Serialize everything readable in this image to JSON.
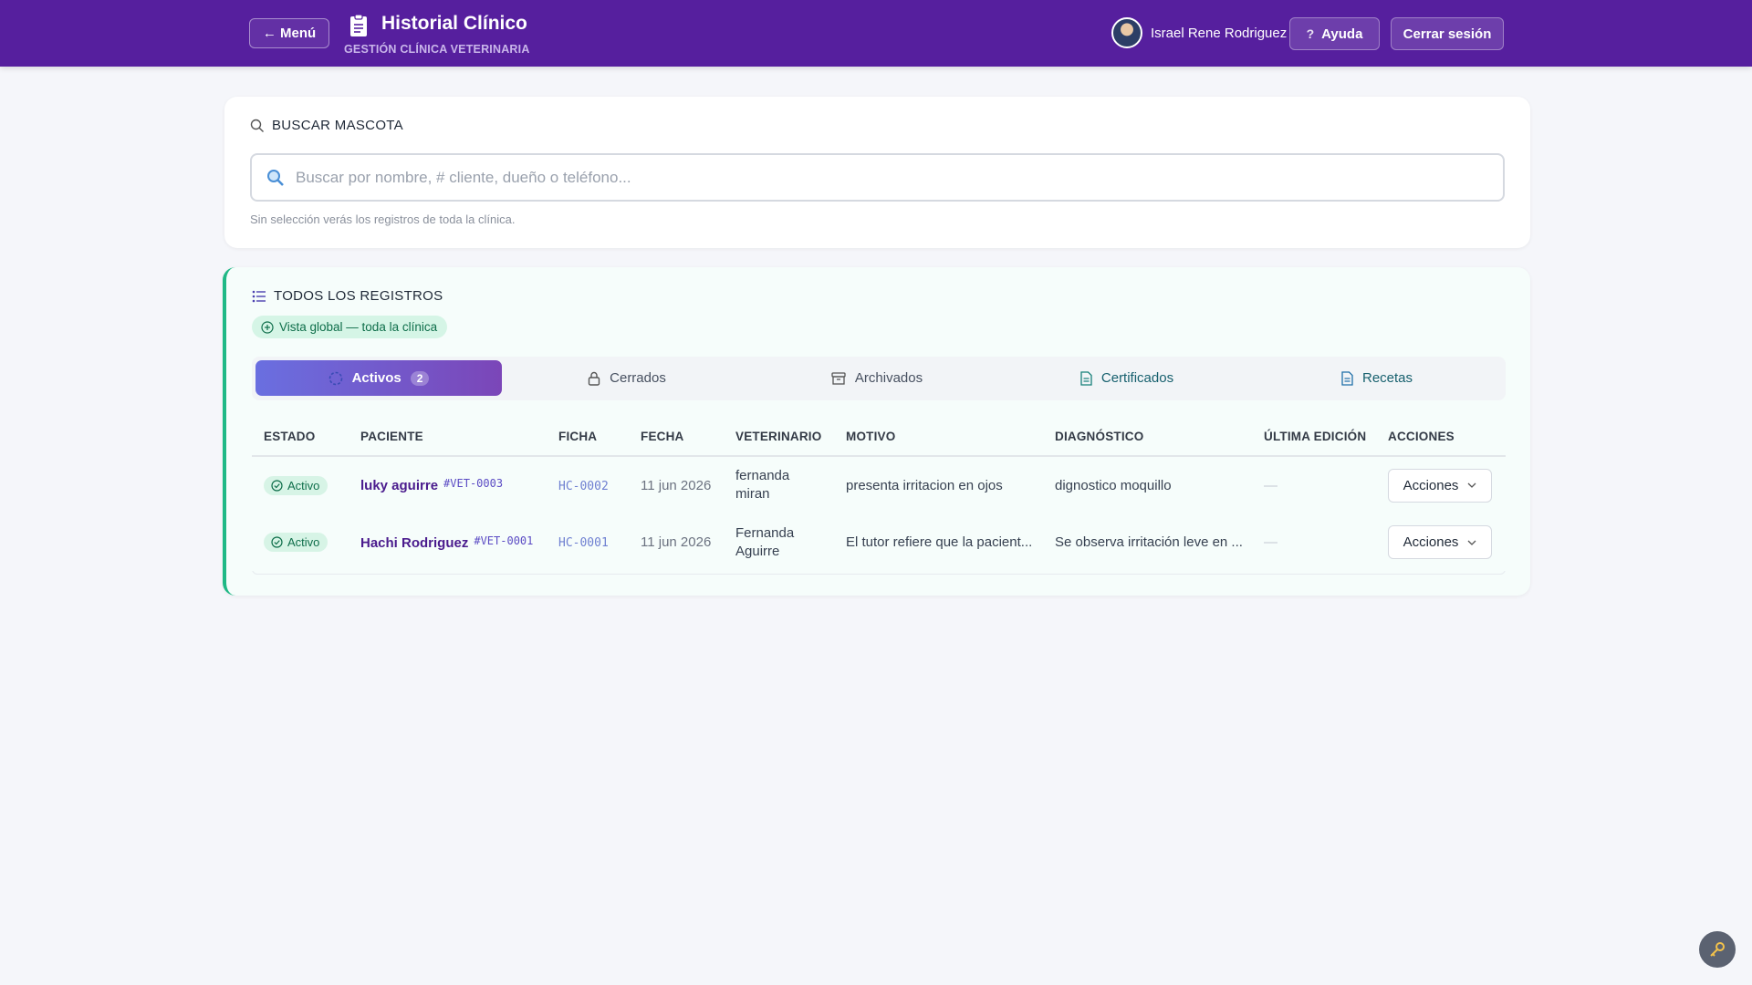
{
  "header": {
    "menu_label": "← Menú",
    "title": "Historial Clínico",
    "subtitle": "GESTIÓN CLÍNICA VETERINARIA",
    "user_name": "Israel Rene Rodriguez",
    "help_label": "Ayuda",
    "logout_label": "Cerrar sesión"
  },
  "search": {
    "section_title": "BUSCAR MASCOTA",
    "placeholder": "Buscar por nombre, # cliente, dueño o teléfono...",
    "value": "",
    "hint": "Sin selección verás los registros de toda la clínica."
  },
  "records": {
    "section_title": "TODOS LOS REGISTROS",
    "chip_label": "Vista global — toda la clínica",
    "tabs": [
      {
        "label": "Activos",
        "count": "2",
        "icon": "circle-icon"
      },
      {
        "label": "Cerrados",
        "icon": "lock-icon"
      },
      {
        "label": "Archivados",
        "icon": "archive-icon"
      },
      {
        "label": "Certificados",
        "icon": "document-icon"
      },
      {
        "label": "Recetas",
        "icon": "document-icon"
      }
    ],
    "columns": [
      "ESTADO",
      "PACIENTE",
      "FICHA",
      "FECHA",
      "VETERINARIO",
      "MOTIVO",
      "DIAGNÓSTICO",
      "ÚLTIMA EDICIÓN",
      "ACCIONES"
    ],
    "rows": [
      {
        "status": "Activo",
        "patient": "luky aguirre",
        "patient_id": "#VET-0003",
        "ficha": "HC-0002",
        "date": "11 jun 2026",
        "vet_line1": "fernanda",
        "vet_line2": "miran",
        "reason": "presenta irritacion en ojos",
        "diagnosis": "dignostico moquillo",
        "last_edit": "—",
        "actions_label": "Acciones"
      },
      {
        "status": "Activo",
        "patient": "Hachi Rodriguez",
        "patient_id": "#VET-0001",
        "ficha": "HC-0001",
        "date": "11 jun 2026",
        "vet_line1": "Fernanda",
        "vet_line2": "Aguirre",
        "reason": "El tutor refiere que la pacient...",
        "diagnosis": "Se observa irritación leve en ...",
        "last_edit": "—",
        "actions_label": "Acciones"
      }
    ]
  },
  "colors": {
    "header_bg": "#561f9e",
    "accent_green": "#1fb885",
    "tab_active_start": "#6a6fe0",
    "tab_active_end": "#7b46b8"
  }
}
